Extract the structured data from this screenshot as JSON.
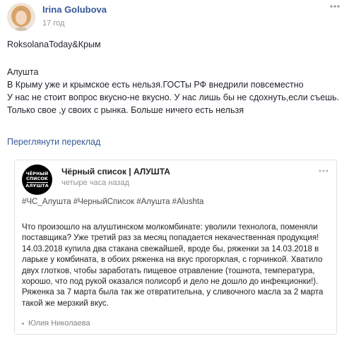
{
  "post": {
    "author": "Irina Golubova",
    "timestamp": "17 год",
    "text_line1": "RoksolanaToday&Крым",
    "body": "Алушта\nВ Крыму уже и крымское есть нельзя.ГОСТы РФ внедрили повсеместно\nУ нас не стоит вопрос вкусно-не вкусно. У нас лишь бы не сдохнуть,если съешь. Только свое ,у своих с рынка. Больше ничего есть нельзя",
    "translate_link": "Переглянути переклад"
  },
  "shared": {
    "avatar_text": [
      "ЧЁРНЫЙ",
      "СПИСОК",
      "АЛУШТА"
    ],
    "name": "Чёрный список | АЛУШТА",
    "time": "четыре часа назад",
    "tags": "#ЧС_Алушта #ЧерныйСписок #Алушта #Alushta",
    "body_lines": [
      "Что произошло на алуштинском молкомбинате: уволили технолога, поменяли",
      "поставщика? Уже третий раз за месяц попадается некачественная продукция!",
      "14.03.2018 купила два стакана свежайшей, вроде бы, ряженки за 14.03.2018 в",
      "ларьке у комбината, в обоих ряженка на вкус прогорклая, с горчинкой. Хватило",
      "двух глотков, чтобы заработать пищевое отравление (тошнота, температура,",
      "хорошо, что под рукой оказался полисорб и дело не дошло до инфекционки!).",
      "Ряженка за 7 марта была так же отвратительна, у сливочного масла за 2 марта",
      "такой же мерзкий вкус."
    ],
    "footer_author": "Юлия Николаева"
  },
  "colors": {
    "link": "#385898",
    "meta": "#90949c",
    "text": "#1d2129"
  },
  "icons": {
    "more": "ellipsis-icon",
    "shared_more": "ellipsis-icon",
    "footer": "dot-icon"
  }
}
